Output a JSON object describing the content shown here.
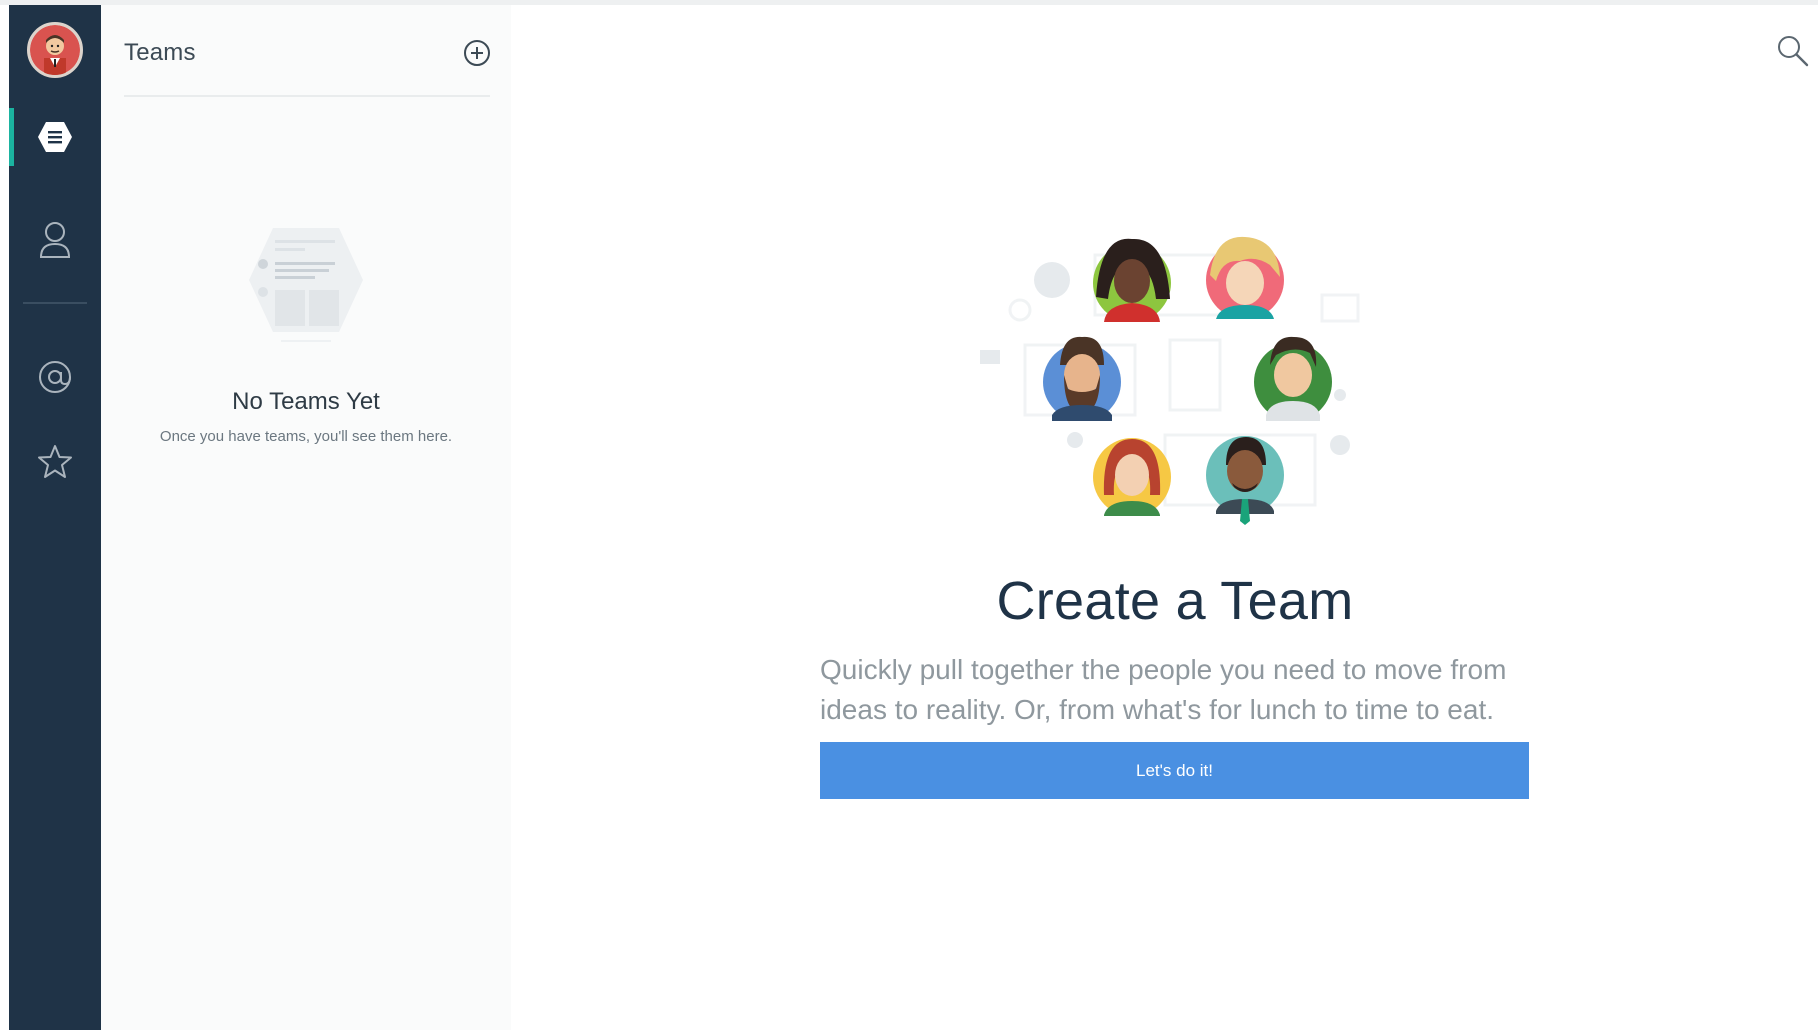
{
  "rail": {
    "avatar_icon": "user-avatar",
    "items": [
      {
        "icon": "teams-icon",
        "active": true
      },
      {
        "icon": "person-icon",
        "active": false
      },
      {
        "icon": "at-sign-icon",
        "active": false
      },
      {
        "icon": "star-icon",
        "active": false
      }
    ]
  },
  "panel": {
    "title": "Teams",
    "add_icon": "plus-circle-icon",
    "empty_title": "No Teams Yet",
    "empty_subtitle": "Once you have teams, you'll see them here."
  },
  "main": {
    "search_icon": "search-icon",
    "title": "Create a Team",
    "description": "Quickly pull together the people you need to move from ideas to reality. Or, from what's for lunch to time to eat.",
    "cta_label": "Let's do it!"
  },
  "colors": {
    "rail_bg": "#1f3347",
    "active_accent": "#1bb3a0",
    "cta_bg": "#4a90e2",
    "title_text": "#1f3347",
    "muted_text": "#8f989e"
  }
}
